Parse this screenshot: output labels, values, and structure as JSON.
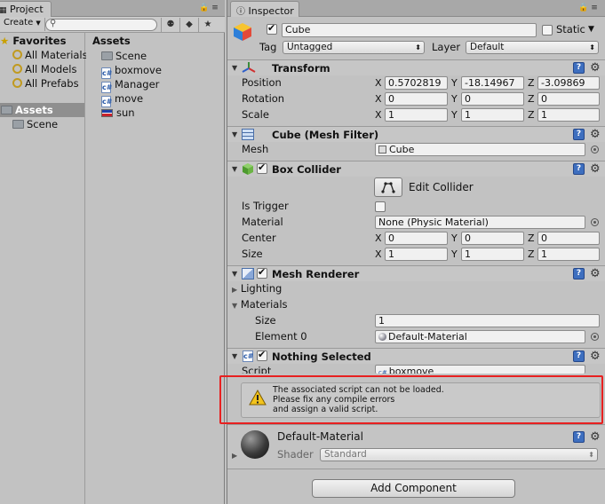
{
  "project": {
    "tab_label": "Project",
    "create_label": "Create",
    "favorites_label": "Favorites",
    "favorites": [
      "All Materials",
      "All Models",
      "All Prefabs"
    ],
    "assets_tree_label": "Assets",
    "assets_tree_children": [
      "Scene"
    ],
    "assets_header": "Assets",
    "asset_items": [
      {
        "name": "Scene",
        "icon": "folder-icon"
      },
      {
        "name": "boxmove",
        "icon": "csharp-script-icon"
      },
      {
        "name": "Manager",
        "icon": "csharp-script-icon"
      },
      {
        "name": "move",
        "icon": "csharp-script-icon"
      },
      {
        "name": "sun",
        "icon": "scene-icon"
      }
    ]
  },
  "inspector": {
    "tab_label": "Inspector",
    "object": {
      "name": "Cube",
      "static_label": "Static",
      "tag_label": "Tag",
      "tag_value": "Untagged",
      "layer_label": "Layer",
      "layer_value": "Default"
    },
    "transform": {
      "title": "Transform",
      "position_label": "Position",
      "rotation_label": "Rotation",
      "scale_label": "Scale",
      "axis_x": "X",
      "axis_y": "Y",
      "axis_z": "Z",
      "position": [
        "0.5702819",
        "-18.14967",
        "-3.09869"
      ],
      "rotation": [
        "0",
        "0",
        "0"
      ],
      "scale": [
        "1",
        "1",
        "1"
      ]
    },
    "mesh_filter": {
      "title": "Cube (Mesh Filter)",
      "mesh_label": "Mesh",
      "mesh_value": "Cube"
    },
    "box_collider": {
      "title": "Box Collider",
      "edit_label": "Edit Collider",
      "is_trigger_label": "Is Trigger",
      "material_label": "Material",
      "material_value": "None (Physic Material)",
      "center_label": "Center",
      "size_label": "Size",
      "center": [
        "0",
        "0",
        "0"
      ],
      "size": [
        "1",
        "1",
        "1"
      ]
    },
    "mesh_renderer": {
      "title": "Mesh Renderer",
      "lighting_label": "Lighting",
      "materials_label": "Materials",
      "size_label": "Size",
      "size_value": "1",
      "element0_label": "Element 0",
      "element0_value": "Default-Material"
    },
    "script_component": {
      "title": "Nothing Selected",
      "script_label": "Script",
      "script_value": "boxmove",
      "warning_line1": "The associated script can not be loaded.",
      "warning_line2": "Please fix any compile errors",
      "warning_line3": "and assign a valid script."
    },
    "material": {
      "name": "Default-Material",
      "shader_label": "Shader",
      "shader_value": "Standard"
    },
    "add_component_label": "Add Component"
  },
  "colors": {
    "highlight_frame": "#e82020",
    "panel_bg": "#c2c2c2",
    "help_icon": "#3e6fbf"
  }
}
